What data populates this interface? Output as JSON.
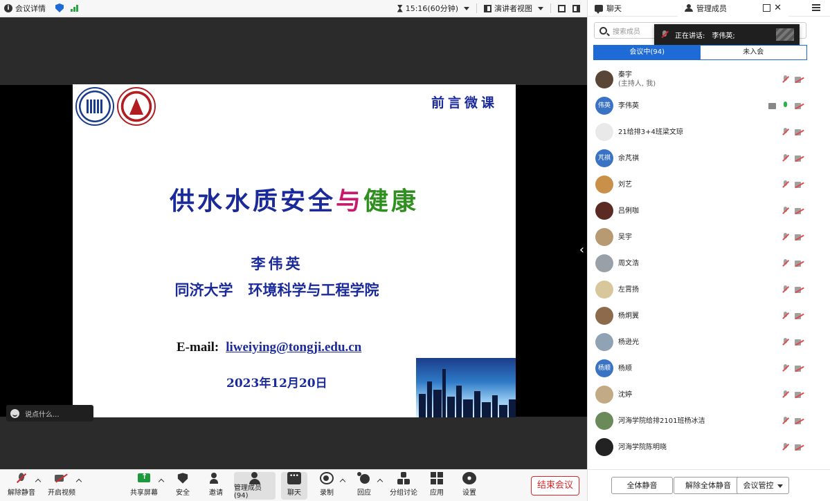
{
  "topbar": {
    "meeting_info": "会议详情",
    "timer": "15:16(60分钟)",
    "view_mode": "演讲者视图"
  },
  "slide": {
    "tag": "前言微课",
    "title_part1": "供水水质安全",
    "title_part2": "与",
    "title_part3": "健康",
    "author": "李伟英",
    "institution": "同济大学   环境科学与工程学院",
    "email_label": "E-mail:",
    "email": "liweiying@tongji.edu.cn",
    "date": "2023年12月20日"
  },
  "chat_input": {
    "placeholder": "说点什么..."
  },
  "toolbar": {
    "unmute": "解除静音",
    "start_video": "开启视频",
    "share_screen": "共享屏幕",
    "security": "安全",
    "invite": "邀请",
    "members": "管理成员(94)",
    "chat": "聊天",
    "record": "录制",
    "react": "回应",
    "breakout": "分组讨论",
    "apps": "应用",
    "settings": "设置",
    "end_meeting": "结束会议"
  },
  "panel": {
    "tab_chat": "聊天",
    "tab_members": "管理成员",
    "search_placeholder": "搜索成员",
    "speaking_label": "正在讲话:",
    "speaking_name": "李伟英;",
    "seg_in_meeting": "会议中(94)",
    "seg_not_joined": "未入会",
    "mute_all": "全体静音",
    "unmute_all": "解除全体静音",
    "meeting_control": "会议管控"
  },
  "members": [
    {
      "name": "秦宇",
      "sub": "(主持人, 我)",
      "avatar": "",
      "color": "#5a4636",
      "mic": "off",
      "share": false
    },
    {
      "name": "李伟英",
      "sub": "",
      "avatar": "伟英",
      "color": "#3b73c4",
      "mic": "on",
      "share": true
    },
    {
      "name": "21给排3+4班梁文琼",
      "sub": "",
      "avatar": "",
      "color": "#e9e9e9",
      "mic": "off",
      "share": false
    },
    {
      "name": "余芃祺",
      "sub": "",
      "avatar": "芃祺",
      "color": "#3b73c4",
      "mic": "off",
      "share": false
    },
    {
      "name": "刘艺",
      "sub": "",
      "avatar": "",
      "color": "#c9904a",
      "mic": "off",
      "share": false
    },
    {
      "name": "吕俐咖",
      "sub": "",
      "avatar": "",
      "color": "#5b2a22",
      "mic": "off",
      "share": false
    },
    {
      "name": "吴宇",
      "sub": "",
      "avatar": "",
      "color": "#b79a72",
      "mic": "off",
      "share": false
    },
    {
      "name": "周文浩",
      "sub": "",
      "avatar": "",
      "color": "#9aa0a8",
      "mic": "off",
      "share": false
    },
    {
      "name": "左霄扬",
      "sub": "",
      "avatar": "",
      "color": "#d8c79a",
      "mic": "off",
      "share": false
    },
    {
      "name": "杨炯翼",
      "sub": "",
      "avatar": "",
      "color": "#8e6a4c",
      "mic": "off",
      "share": false
    },
    {
      "name": "杨逊光",
      "sub": "",
      "avatar": "",
      "color": "#8fa3b5",
      "mic": "off",
      "share": false
    },
    {
      "name": "杨顺",
      "sub": "",
      "avatar": "杨顺",
      "color": "#3b73c4",
      "mic": "off",
      "share": false
    },
    {
      "name": "沈婷",
      "sub": "",
      "avatar": "",
      "color": "#c2ab84",
      "mic": "off",
      "share": false
    },
    {
      "name": "河海学院给排2101班杨冰洁",
      "sub": "",
      "avatar": "",
      "color": "#6a8a5a",
      "mic": "off",
      "share": false
    },
    {
      "name": "河海学院陈明晓",
      "sub": "",
      "avatar": "",
      "color": "#222222",
      "mic": "off",
      "share": false
    }
  ],
  "colors": {
    "accent": "#1e6bd6",
    "end_red": "#d9262c",
    "slide_blue": "#1b2a9b",
    "slide_pink": "#c8196b",
    "slide_green": "#2f8f1f"
  }
}
